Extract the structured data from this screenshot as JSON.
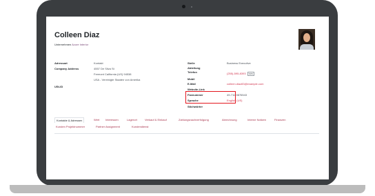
{
  "contact": {
    "name": "Colleen Diaz",
    "company_prefix": "Unternehmen",
    "company_link": "Azure Interior"
  },
  "left_fields": {
    "adressart_label": "Adressart",
    "adressart_value": "Kontakt",
    "company_address_label": "Company Address",
    "address_line1": "4557 De Silva St",
    "address_line2": "Fremont  California (US)  94538",
    "address_line3": "USA - Vereinigte Staaten von Amerika",
    "ust_label": "USt-ID"
  },
  "right_fields": {
    "stelle_label": "Stelle",
    "stelle_value": "Business Executive",
    "abteilung_label": "Abteilung",
    "telefon_label": "Telefon",
    "telefon_value": "(255)-595-8393",
    "sms_badge": "SMS",
    "mobil_label": "Mobil",
    "email_label": "E-Mail",
    "email_value": "colleen.diaz83@example.com",
    "website_label": "Website-Link",
    "fax_label": "Faxnummer",
    "fax_value": "49-711-9876543",
    "sprache_label": "Sprache",
    "sprache_value": "English (US)",
    "stichwoerter_label": "Stichwörter"
  },
  "tabs": {
    "row1": [
      "Kontakte & Adressen",
      "Wert",
      "Interessen",
      "Lagerort",
      "Verkauf & Einkauf",
      "Zahlungsnachverfolgung",
      "Abrechnung",
      "Interne Notizen",
      "Finanzen"
    ],
    "row2": [
      "Kunden Projektnummer",
      "Partner Assignment",
      "Kundendienst"
    ]
  },
  "colors": {
    "highlight": "#e3161d",
    "link": "#a8324b",
    "laptop_frame": "#3a3d40"
  }
}
